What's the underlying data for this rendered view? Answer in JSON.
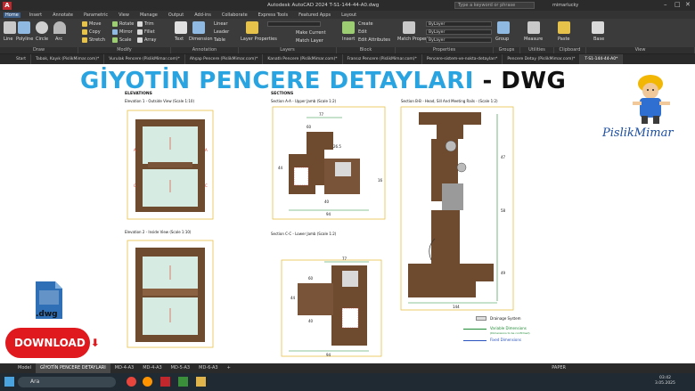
{
  "app": {
    "title": "Autodesk AutoCAD 2024    T-S1-144-44-A0.dwg",
    "search_placeholder": "Type a keyword or phrase",
    "user": "mimarlucky",
    "logo": "A"
  },
  "ribbon_tabs": [
    "Home",
    "Insert",
    "Annotate",
    "Parametric",
    "View",
    "Manage",
    "Output",
    "Add-ins",
    "Collaborate",
    "Express Tools",
    "Featured Apps",
    "Layout"
  ],
  "ribbon_active_tab": "Home",
  "ribbon": {
    "draw": [
      "Line",
      "Polyline",
      "Circle",
      "Arc"
    ],
    "modify": [
      "Move",
      "Rotate",
      "Trim",
      "Copy",
      "Mirror",
      "Fillet",
      "Stretch",
      "Scale",
      "Array"
    ],
    "annotation": [
      "Text",
      "Dimension",
      "Linear",
      "Leader",
      "Table"
    ],
    "layers": [
      "Layer Properties",
      "Make Current",
      "Match Layer"
    ],
    "block": [
      "Insert",
      "Create",
      "Edit",
      "Edit Attributes"
    ],
    "properties": [
      "Match Properties",
      "ByLayer",
      "ByLayer",
      "ByLayer"
    ],
    "groups": [
      "Group"
    ],
    "utilities": [
      "Measure"
    ],
    "clipboard": [
      "Paste"
    ],
    "view": [
      "Base"
    ],
    "panel_titles": [
      "Draw",
      "Modify",
      "Annotation",
      "Layers",
      "Block",
      "Properties",
      "Groups",
      "Utilities",
      "Clipboard",
      "View"
    ]
  },
  "doc_tabs": [
    "Start",
    "Tabak, Kayık (PislikMimar.com)*",
    "Vurulak Pencere (PislikMimar.com)*",
    "Ahşap Pencere (PislikMimar.com)*",
    "Kanatlı Pencere (PislikMimar.com)*",
    "Fransız Pencere (PislikMimar.com)*",
    "Pencere-sistem-ve-nokta-detayları*",
    "Pencere Detay (PislikMimar.com)*",
    "T-S1-144-44-A0*"
  ],
  "doc_active_tab": "T-S1-144-44-A0*",
  "banner": {
    "title_blue": "GİYOTİN PENCERE DETAYLARI",
    "title_dark": " - DWG",
    "brand": "PislikMimar",
    "download": "DOWNLOAD",
    "download_arrow": "⬇",
    "file_ext": ".dwg"
  },
  "drawing": {
    "elevations_heading": "ELEVATIONS",
    "elevation1": "Elevation 1 - Outside View (Scale 1:10)",
    "elevation2": "Elevation 2 - Inside View (Scale 1:10)",
    "sections_heading": "SECTIONS",
    "sectionA": "Section A-A - Upper Jamb (Scale 1:2)",
    "sectionB": "Section B-B - Head, Sill And Meeting Rails - (Scale 1:2)",
    "sectionC": "Section C-C - Lower Jamb (Scale 1:2)",
    "legend": [
      "Drainage System",
      "Variable Dimensions",
      "(Dimensions to be confirmed)",
      "Fixed Dimensions"
    ],
    "dims": [
      "77",
      "26.5",
      "60",
      "40",
      "44",
      "94",
      "16",
      "77",
      "60",
      "40",
      "44",
      "94",
      "144",
      "47",
      "58",
      "49"
    ]
  },
  "layout_tabs": [
    "Model",
    "GİYOTİN PENCERE DETAYLARI",
    "MD-4-A3",
    "MD-4-A3",
    "MD-5-A3",
    "MD-6-A3",
    "+"
  ],
  "layout_active": "GİYOTİN PENCERE DETAYLARI",
  "status": {
    "paper": "PAPER"
  },
  "taskbar": {
    "search": "Ara",
    "time": "03:42",
    "date": "3.05.2025"
  },
  "colors": {
    "accent": "#29a4e0",
    "frame": "#6e4a2e",
    "download": "#e0191e",
    "brand": "#1b4ea0"
  }
}
